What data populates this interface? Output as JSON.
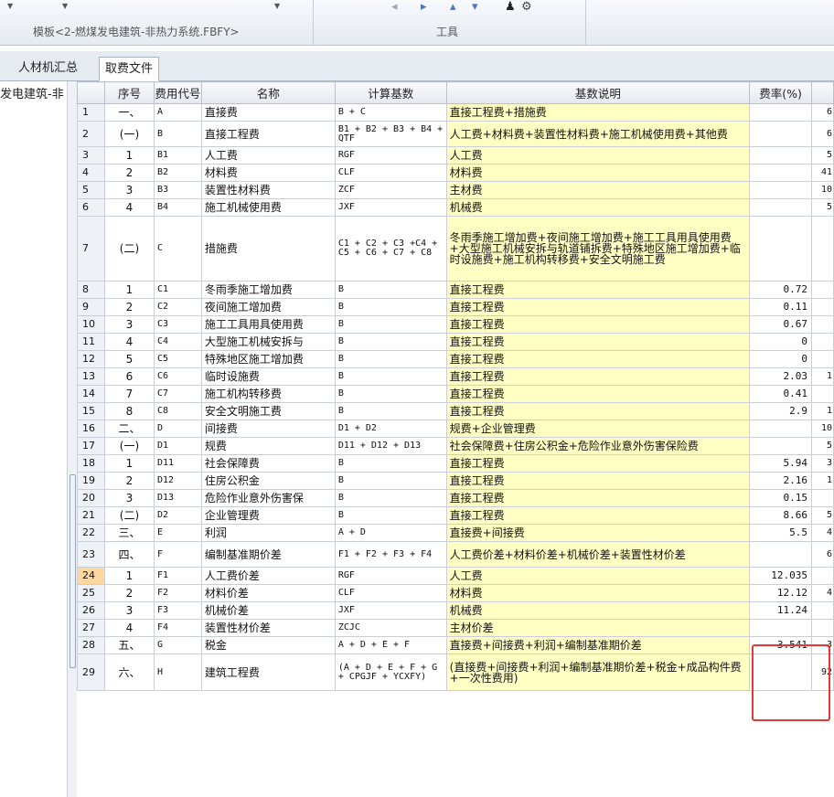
{
  "ribbon": {
    "template_label": "模板<2-燃煤发电建筑-非热力系统.FBFY>",
    "tools_label": "工具"
  },
  "tabs": [
    {
      "label": "人材机汇总"
    },
    {
      "label": "取费文件"
    }
  ],
  "tree": {
    "item": "发电建筑-非"
  },
  "columns": [
    "序号",
    "费用代号",
    "名称",
    "计算基数",
    "基数说明",
    "费率(%)"
  ],
  "rows": [
    {
      "idx": "1",
      "seq": "一、",
      "code": "A",
      "name": "直接费",
      "base": "B + C",
      "desc": "直接工程费+措施费",
      "rate": "",
      "extra": "6"
    },
    {
      "idx": "2",
      "seq": "(一)",
      "code": "B",
      "name": "直接工程费",
      "base": "B1 + B2 + B3 + B4 + QTF",
      "desc": "人工费+材料费+装置性材料费+施工机械使用费+其他费",
      "rate": "",
      "extra": "6"
    },
    {
      "idx": "3",
      "seq": "1",
      "code": "B1",
      "name": "人工费",
      "base": "RGF",
      "desc": "人工费",
      "rate": "",
      "extra": "5"
    },
    {
      "idx": "4",
      "seq": "2",
      "code": "B2",
      "name": "材料费",
      "base": "CLF",
      "desc": "材料费",
      "rate": "",
      "extra": "41"
    },
    {
      "idx": "5",
      "seq": "3",
      "code": "B3",
      "name": "装置性材料费",
      "base": "ZCF",
      "desc": "主材费",
      "rate": "",
      "extra": "10"
    },
    {
      "idx": "6",
      "seq": "4",
      "code": "B4",
      "name": "施工机械使用费",
      "base": "JXF",
      "desc": "机械费",
      "rate": "",
      "extra": "5"
    },
    {
      "idx": "7",
      "seq": "(二)",
      "code": "C",
      "name": "措施费",
      "base": "C1 + C2 + C3 +C4 + C5 + C6 + C7 + C8",
      "desc": "冬雨季施工增加费+夜间施工增加费+施工工具用具使用费+大型施工机械安拆与轨道铺拆费+特殊地区施工增加费+临时设施费+施工机构转移费+安全文明施工费",
      "rate": "",
      "extra": ""
    },
    {
      "idx": "8",
      "seq": "1",
      "code": "C1",
      "name": "冬雨季施工增加费",
      "base": "B",
      "desc": "直接工程费",
      "rate": "0.72",
      "extra": ""
    },
    {
      "idx": "9",
      "seq": "2",
      "code": "C2",
      "name": "夜间施工增加费",
      "base": "B",
      "desc": "直接工程费",
      "rate": "0.11",
      "extra": ""
    },
    {
      "idx": "10",
      "seq": "3",
      "code": "C3",
      "name": "施工工具用具使用费",
      "base": "B",
      "desc": "直接工程费",
      "rate": "0.67",
      "extra": ""
    },
    {
      "idx": "11",
      "seq": "4",
      "code": "C4",
      "name": "大型施工机械安拆与",
      "base": "B",
      "desc": "直接工程费",
      "rate": "0",
      "extra": ""
    },
    {
      "idx": "12",
      "seq": "5",
      "code": "C5",
      "name": "特殊地区施工增加费",
      "base": "B",
      "desc": "直接工程费",
      "rate": "0",
      "extra": ""
    },
    {
      "idx": "13",
      "seq": "6",
      "code": "C6",
      "name": "临时设施费",
      "base": "B",
      "desc": "直接工程费",
      "rate": "2.03",
      "extra": "1"
    },
    {
      "idx": "14",
      "seq": "7",
      "code": "C7",
      "name": "施工机构转移费",
      "base": "B",
      "desc": "直接工程费",
      "rate": "0.41",
      "extra": ""
    },
    {
      "idx": "15",
      "seq": "8",
      "code": "C8",
      "name": "安全文明施工费",
      "base": "B",
      "desc": "直接工程费",
      "rate": "2.9",
      "extra": "1"
    },
    {
      "idx": "16",
      "seq": "二、",
      "code": "D",
      "name": "间接费",
      "base": "D1 + D2",
      "desc": "规费+企业管理费",
      "rate": "",
      "extra": "10"
    },
    {
      "idx": "17",
      "seq": "(一)",
      "code": "D1",
      "name": "规费",
      "base": "D11 + D12 + D13",
      "desc": "社会保障费+住房公积金+危险作业意外伤害保险费",
      "rate": "",
      "extra": "5"
    },
    {
      "idx": "18",
      "seq": "1",
      "code": "D11",
      "name": "社会保障费",
      "base": "B",
      "desc": "直接工程费",
      "rate": "5.94",
      "extra": "3"
    },
    {
      "idx": "19",
      "seq": "2",
      "code": "D12",
      "name": "住房公积金",
      "base": "B",
      "desc": "直接工程费",
      "rate": "2.16",
      "extra": "1"
    },
    {
      "idx": "20",
      "seq": "3",
      "code": "D13",
      "name": "危险作业意外伤害保",
      "base": "B",
      "desc": "直接工程费",
      "rate": "0.15",
      "extra": ""
    },
    {
      "idx": "21",
      "seq": "(二)",
      "code": "D2",
      "name": "企业管理费",
      "base": "B",
      "desc": "直接工程费",
      "rate": "8.66",
      "extra": "5"
    },
    {
      "idx": "22",
      "seq": "三、",
      "code": "E",
      "name": "利润",
      "base": "A + D",
      "desc": "直接费+间接费",
      "rate": "5.5",
      "extra": "4"
    },
    {
      "idx": "23",
      "seq": "四、",
      "code": "F",
      "name": "编制基准期价差",
      "base": "F1 + F2 + F3 + F4",
      "desc": "人工费价差+材料价差+机械价差+装置性材价差",
      "rate": "",
      "extra": "6"
    },
    {
      "idx": "24",
      "seq": "1",
      "code": "F1",
      "name": "人工费价差",
      "base": "RGF",
      "desc": "人工费",
      "rate": "12.035",
      "extra": ""
    },
    {
      "idx": "25",
      "seq": "2",
      "code": "F2",
      "name": "材料价差",
      "base": "CLF",
      "desc": "材料费",
      "rate": "12.12",
      "extra": "4"
    },
    {
      "idx": "26",
      "seq": "3",
      "code": "F3",
      "name": "机械价差",
      "base": "JXF",
      "desc": "机械费",
      "rate": "11.24",
      "extra": ""
    },
    {
      "idx": "27",
      "seq": "4",
      "code": "F4",
      "name": "装置性材价差",
      "base": "ZCJC",
      "desc": "主材价差",
      "rate": "",
      "extra": ""
    },
    {
      "idx": "28",
      "seq": "五、",
      "code": "G",
      "name": "税金",
      "base": "A + D + E + F",
      "desc": "直接费+间接费+利润+编制基准期价差",
      "rate": "3.541",
      "extra": "3"
    },
    {
      "idx": "29",
      "seq": "六、",
      "code": "H",
      "name": "建筑工程费",
      "base": "(A + D + E + F + G + CPGJF + YCXFY)",
      "desc": "(直接费+间接费+利润+编制基准期价差+税金+成品构件费+一次性费用)",
      "rate": "",
      "extra": "92"
    }
  ],
  "selected_row": "24"
}
